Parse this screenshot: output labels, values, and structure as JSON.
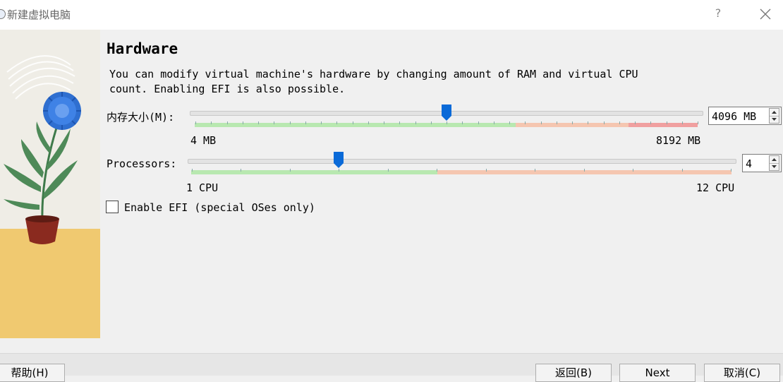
{
  "window": {
    "title": "新建虚拟电脑",
    "help_glyph": "?",
    "close_icon": "close-icon"
  },
  "page": {
    "heading": "Hardware",
    "description": "You can modify virtual machine's hardware by changing amount of RAM and virtual CPU\ncount. Enabling EFI is also possible."
  },
  "memory": {
    "label": "内存大小(M):",
    "value": 4096,
    "value_text": "4096 MB",
    "min_label": "4 MB",
    "max_label": "8192 MB",
    "min": 4,
    "max": 8192
  },
  "processors": {
    "label": "Processors:",
    "value": 4,
    "value_text": "4",
    "min_label": "1 CPU",
    "max_label": "12 CPU",
    "min": 1,
    "max": 12
  },
  "efi": {
    "label": "Enable EFI (special OSes only)",
    "checked": false
  },
  "buttons": {
    "help": "帮助(H)",
    "back": "返回(B)",
    "next": "Next",
    "cancel": "取消(C)"
  },
  "colors": {
    "thumb": "#0a6ad8",
    "band_green": "#b8e8b0",
    "band_salmon": "#f5c6b0",
    "band_red": "#f0a0a0",
    "illustration_yellow": "#f0c970"
  }
}
